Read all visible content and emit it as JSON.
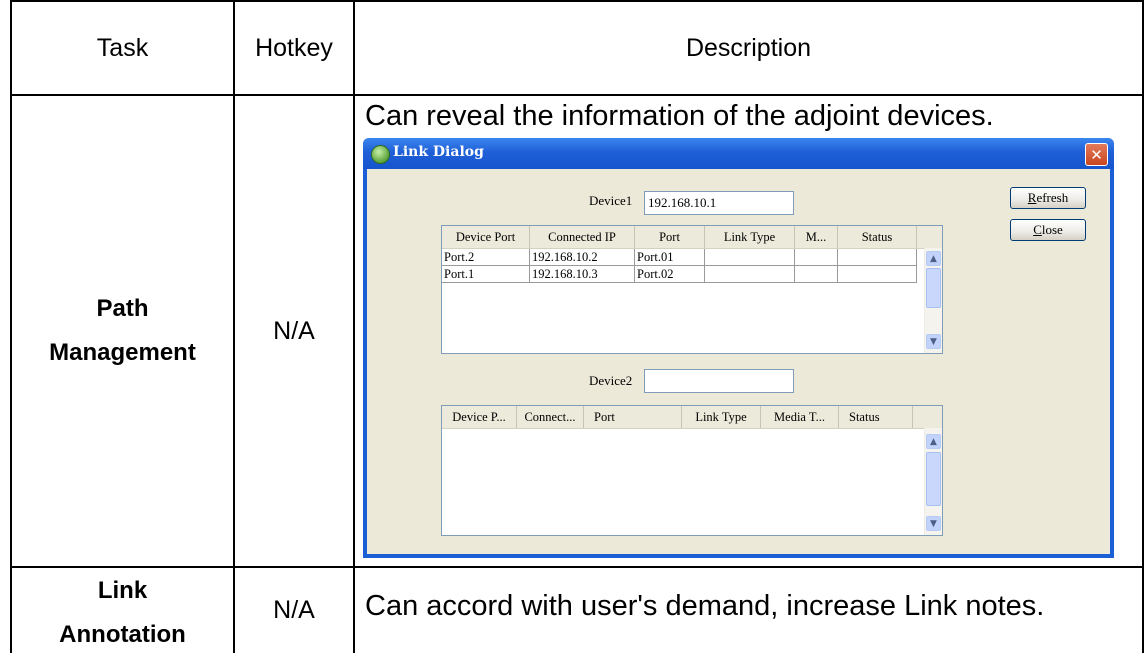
{
  "table": {
    "headers": {
      "task": "Task",
      "hotkey": "Hotkey",
      "description": "Description"
    },
    "rows": [
      {
        "task_line1": "Path",
        "task_line2": "Management",
        "hotkey": "N/A",
        "description": "Can reveal the information of the adjoint devices."
      },
      {
        "task_line1": "Link",
        "task_line2": "Annotation",
        "hotkey": "N/A",
        "description": "Can accord with user's demand, increase Link notes."
      }
    ]
  },
  "dialog": {
    "title": "Link Dialog",
    "icon": "app-globe-icon",
    "close_glyph": "✕",
    "device1_label": "Device1",
    "device1_value": "192.168.10.1",
    "device2_label": "Device2",
    "device2_value": "",
    "refresh_accel": "R",
    "refresh_rest": "efresh",
    "close_accel": "C",
    "close_rest": "lose",
    "list1": {
      "columns": [
        "Device Port",
        "Connected IP",
        "Port",
        "Link Type",
        "M...",
        "Status"
      ],
      "rows": [
        [
          "Port.2",
          "192.168.10.2",
          "Port.01",
          "",
          "",
          ""
        ],
        [
          "Port.1",
          "192.168.10.3",
          "Port.02",
          "",
          "",
          ""
        ]
      ]
    },
    "list2": {
      "columns": [
        "Device P...",
        "Connect...",
        "Port",
        "Link Type",
        "Media T...",
        "Status"
      ],
      "rows": []
    },
    "scroll_up_glyph": "▲",
    "scroll_down_glyph": "▼"
  }
}
